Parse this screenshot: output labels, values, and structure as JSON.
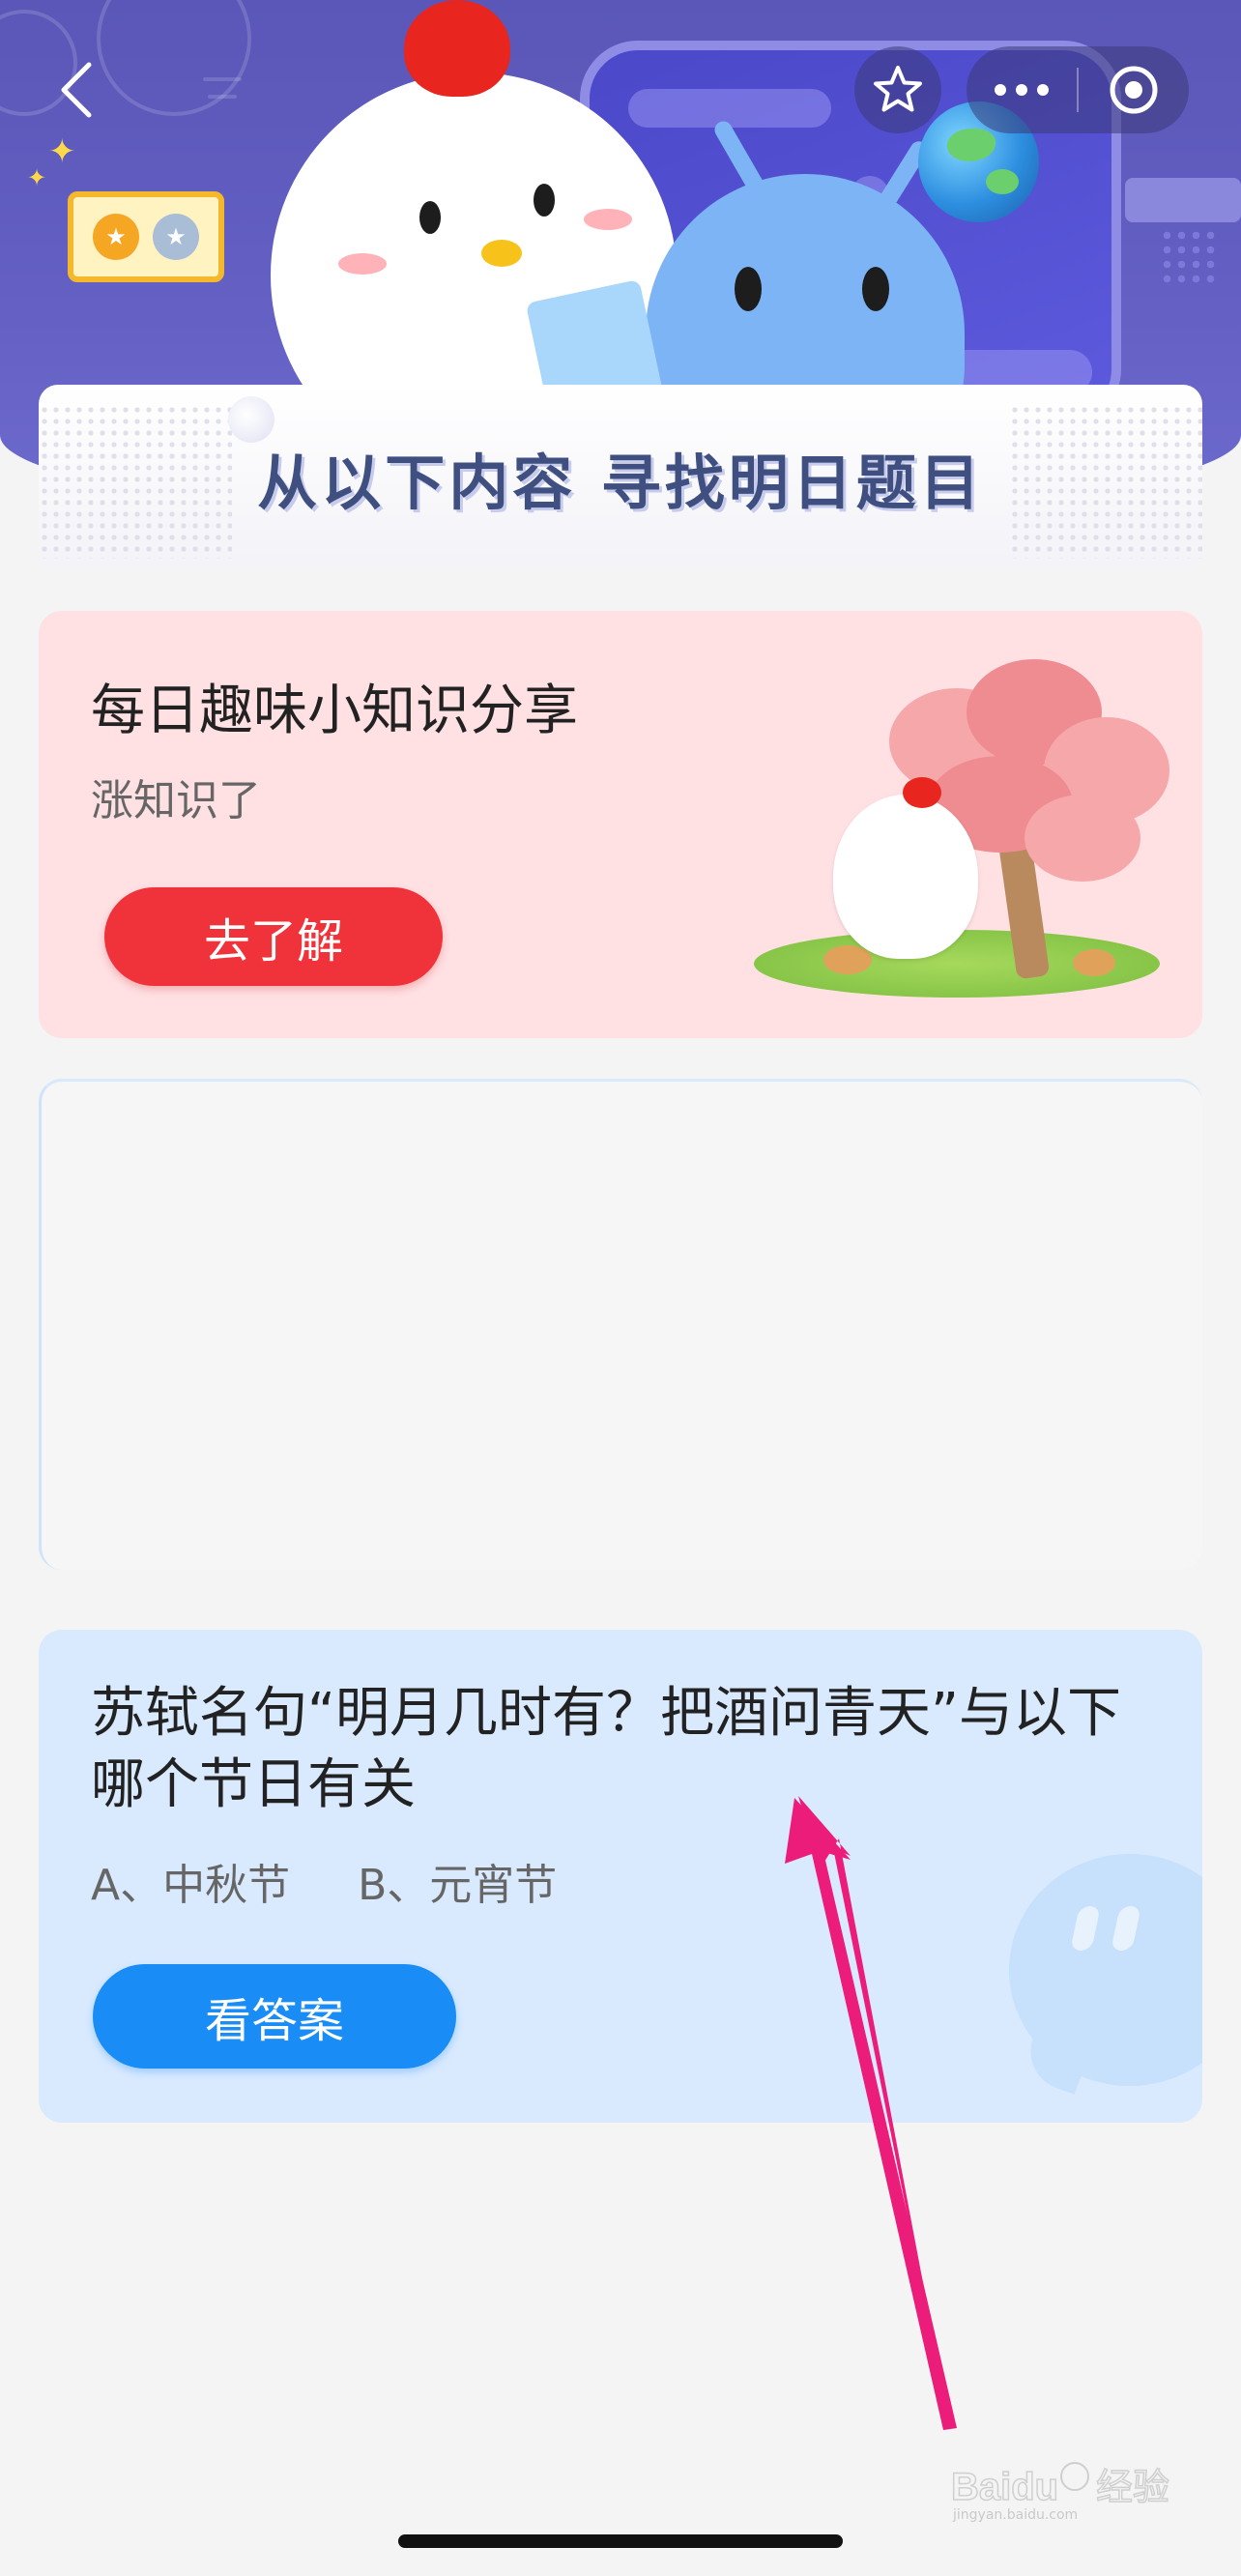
{
  "nav": {
    "back_icon": "chevron-left-icon",
    "favorite_icon": "star-icon",
    "more_icon": "ellipsis-icon",
    "close_icon": "target-circle-icon"
  },
  "banner": {
    "title": "从以下内容  寻找明日题目"
  },
  "knowledge_card": {
    "title": "每日趣味小知识分享",
    "subtitle": "涨知识了",
    "button_label": "去了解",
    "accent_color": "#f0333a",
    "background_color": "#ffe0e3"
  },
  "question_card": {
    "question": "苏轼名句“明月几时有？把酒问青天”与以下哪个节日有关",
    "options": [
      "A、中秋节",
      "B、元宵节"
    ],
    "button_label": "看答案",
    "accent_color": "#1a8cf5",
    "background_color": "#d9eaff"
  },
  "watermark": {
    "brand": "Baidu",
    "brand_cn": "经验",
    "url": "jingyan.baidu.com"
  }
}
